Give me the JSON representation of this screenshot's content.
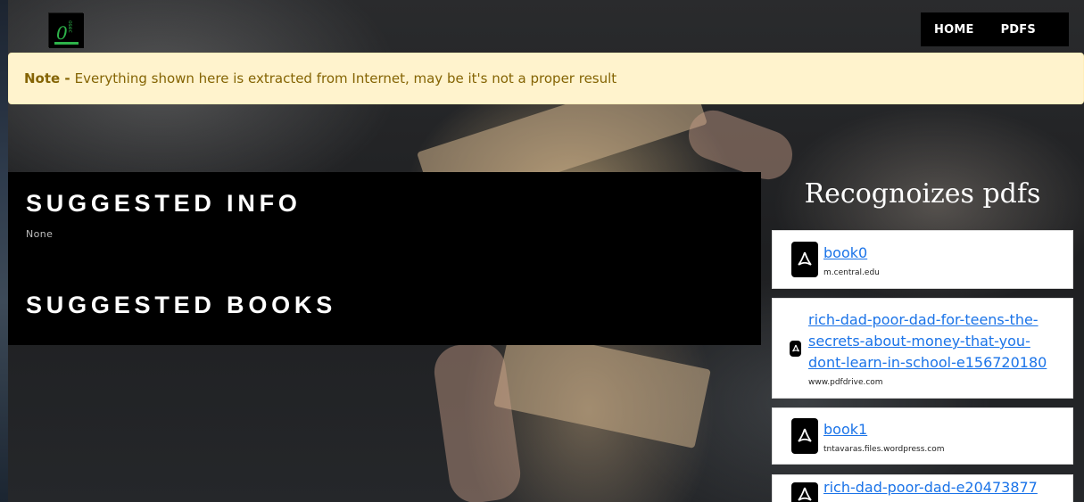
{
  "header": {
    "logo_icon": "osec-logo-icon",
    "nav": [
      {
        "label": "HOME"
      },
      {
        "label": "PDFS"
      }
    ]
  },
  "note": {
    "label": "Note -",
    "text": "Everything shown here is extracted from Internet, may be it's not a proper result"
  },
  "suggested": {
    "info_title": "SUGGESTED INFO",
    "info_value": "None",
    "books_title": "SUGGESTED BOOKS"
  },
  "pdfs": {
    "heading": "Recognoizes pdfs",
    "items": [
      {
        "title": "book0",
        "domain": "m.central.edu",
        "icon": "pdf-icon"
      },
      {
        "title": "rich-dad-poor-dad-for-teens-the-secrets-about-money-that-you-dont-learn-in-school-e156720180",
        "domain": "www.pdfdrive.com",
        "icon": "pdf-icon"
      },
      {
        "title": "book1",
        "domain": "tntavaras.files.wordpress.com",
        "icon": "pdf-icon"
      },
      {
        "title": "rich-dad-poor-dad-e20473877",
        "domain": "",
        "icon": "pdf-icon"
      }
    ]
  },
  "colors": {
    "note_bg": "#fff3cd",
    "note_text": "#856404",
    "link": "#1a73e8",
    "panel_bg": "#000000"
  }
}
